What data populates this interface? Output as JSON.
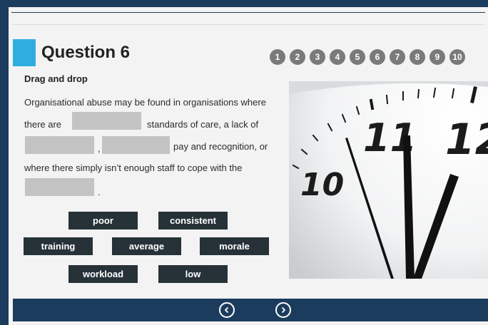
{
  "question": {
    "title": "Question 6",
    "pages": [
      "1",
      "2",
      "3",
      "4",
      "5",
      "6",
      "7",
      "8",
      "9",
      "10"
    ],
    "instruction": "Drag and drop",
    "sentence": {
      "part1": "Organisational abuse may be found in organisations where",
      "part2": "there are",
      "part3": "standards of care, a lack of",
      "comma": ",",
      "part4": "pay and recognition, or",
      "part5": "where there simply isn’t enough staff to cope with the",
      "period": "."
    },
    "options": [
      "poor",
      "consistent",
      "training",
      "average",
      "morale",
      "workload",
      "low"
    ]
  },
  "image": {
    "description": "clock-photo"
  },
  "colors": {
    "accent": "#2eaee0",
    "nav": "#1c3c5e",
    "chip": "#263238",
    "blank": "#c3c3c3"
  }
}
